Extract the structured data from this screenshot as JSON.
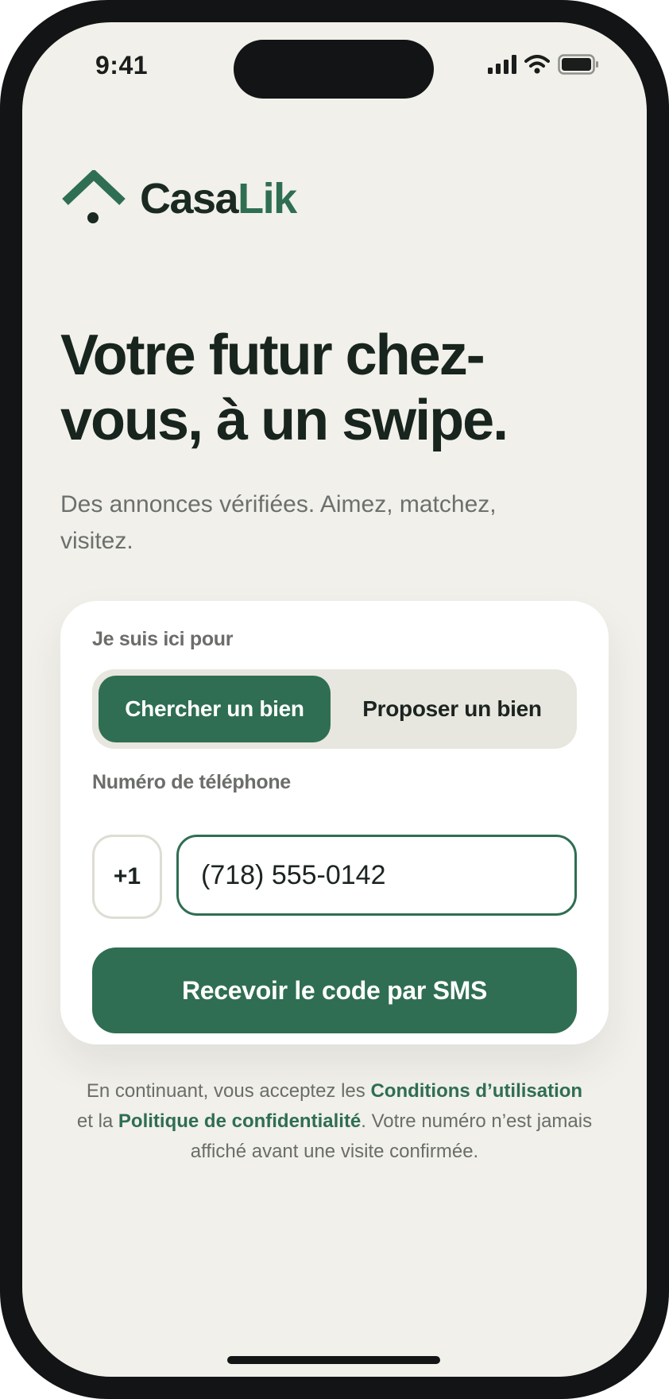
{
  "status_bar": {
    "time": "9:41",
    "icons": [
      "cellular-signal-icon",
      "wifi-icon",
      "battery-icon"
    ]
  },
  "brand": {
    "logo_icon": "house-roof-icon",
    "name_primary": "Casa",
    "name_accent": "Lik"
  },
  "hero": {
    "headline": "Votre futur chez-vous, à un swipe.",
    "subheadline": "Des annonces vérifiées. Aimez, matchez, visitez."
  },
  "form": {
    "role_label": "Je suis ici pour",
    "role_options": [
      {
        "label": "Chercher un bien",
        "selected": true
      },
      {
        "label": "Proposer un bien",
        "selected": false
      }
    ],
    "phone_label": "Numéro de téléphone",
    "country_code": "+1",
    "phone_value": "(718) 555-0142",
    "submit_label": "Recevoir le code par SMS"
  },
  "legal": {
    "prefix": "En continuant, vous acceptez les ",
    "terms_link": "Conditions d’utilisation",
    "middle": " et la ",
    "privacy_link": "Politique de confidentialité",
    "suffix": ". Votre numéro n’est jamais affiché avant une visite confirmée."
  },
  "colors": {
    "accent": "#2f6e52",
    "background": "#f1f0ea",
    "card": "#ffffff",
    "text_primary": "#18241e",
    "text_secondary": "#6a6d69",
    "device_frame": "#121416"
  }
}
